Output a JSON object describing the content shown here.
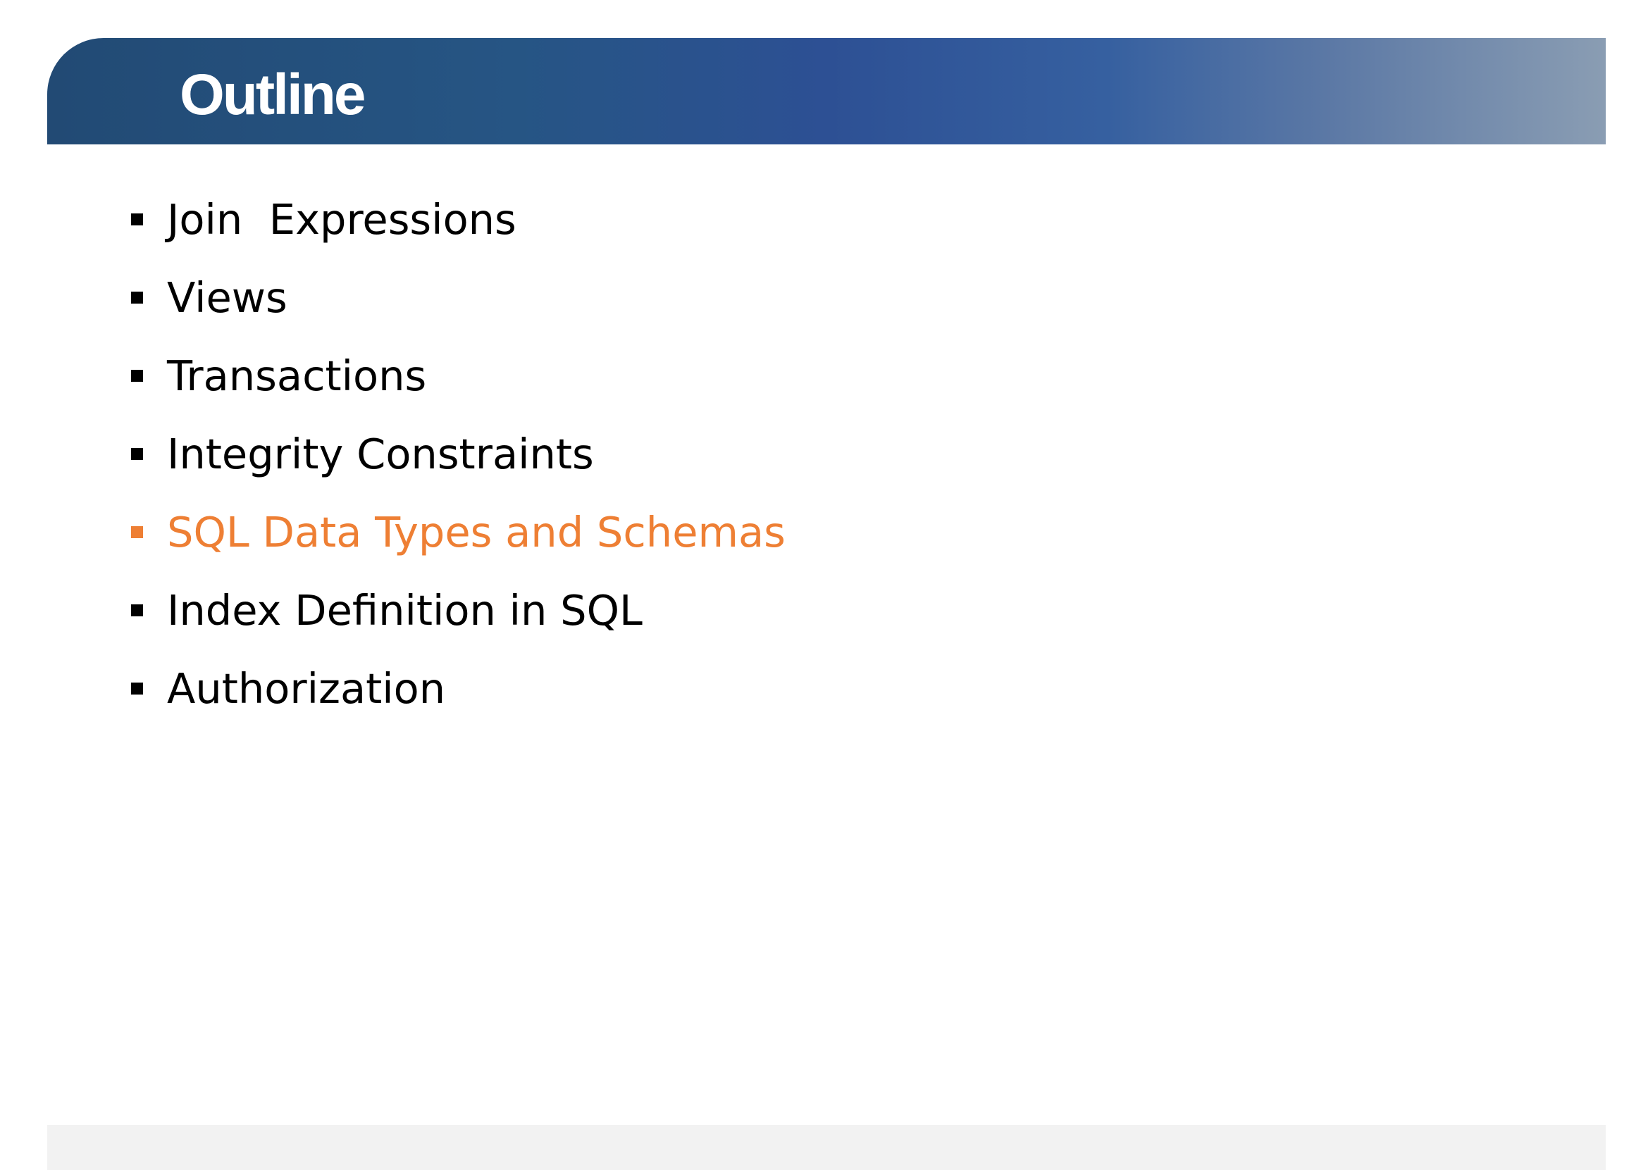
{
  "slide": {
    "title": "Outline",
    "items": [
      {
        "label": "Join  Expressions",
        "active": false
      },
      {
        "label": "Views",
        "active": false
      },
      {
        "label": "Transactions",
        "active": false
      },
      {
        "label": "Integrity Constraints",
        "active": false
      },
      {
        "label": "SQL Data Types and Schemas",
        "active": true
      },
      {
        "label": "Index Definition in SQL",
        "active": false
      },
      {
        "label": "Authorization",
        "active": false
      }
    ]
  },
  "colors": {
    "title_bar_start": "#224a74",
    "title_bar_end": "#8a9db3",
    "active_item": "#ee7f34",
    "text": "#000000",
    "footer_bar": "#f2f2f2"
  },
  "icons": {
    "bullet": "square-bullet-icon"
  }
}
